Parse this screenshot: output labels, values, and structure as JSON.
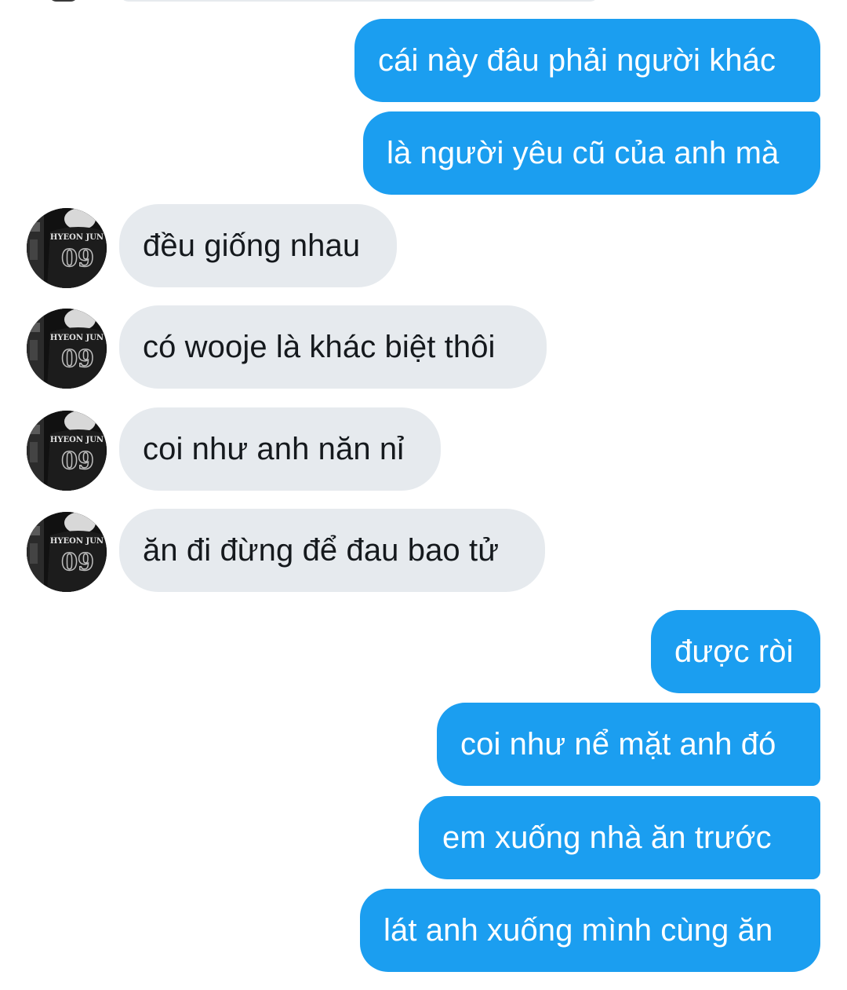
{
  "conversation": {
    "messages": [
      {
        "side": "out",
        "text": "cái này đâu phải người khác"
      },
      {
        "side": "out",
        "text": "là người yêu cũ của anh mà"
      },
      {
        "side": "in",
        "text": "đều giống nhau"
      },
      {
        "side": "in",
        "text": "có wooje là khác biệt thôi"
      },
      {
        "side": "in",
        "text": "coi như anh năn nỉ"
      },
      {
        "side": "in",
        "text": "ăn đi đừng để đau bao tử"
      },
      {
        "side": "out",
        "text": "được ròi"
      },
      {
        "side": "out",
        "text": "coi như nể mặt anh đó"
      },
      {
        "side": "out",
        "text": "em xuống nhà ăn trước"
      },
      {
        "side": "out",
        "text": "lát anh xuống mình cùng ăn"
      }
    ]
  },
  "avatar": {
    "jersey_name": "HYEON JUN",
    "jersey_number": "09"
  },
  "colors": {
    "outgoing_bubble": "#1b9ef0",
    "incoming_bubble": "#e6eaee",
    "outgoing_text": "#ffffff",
    "incoming_text": "#15191d"
  }
}
